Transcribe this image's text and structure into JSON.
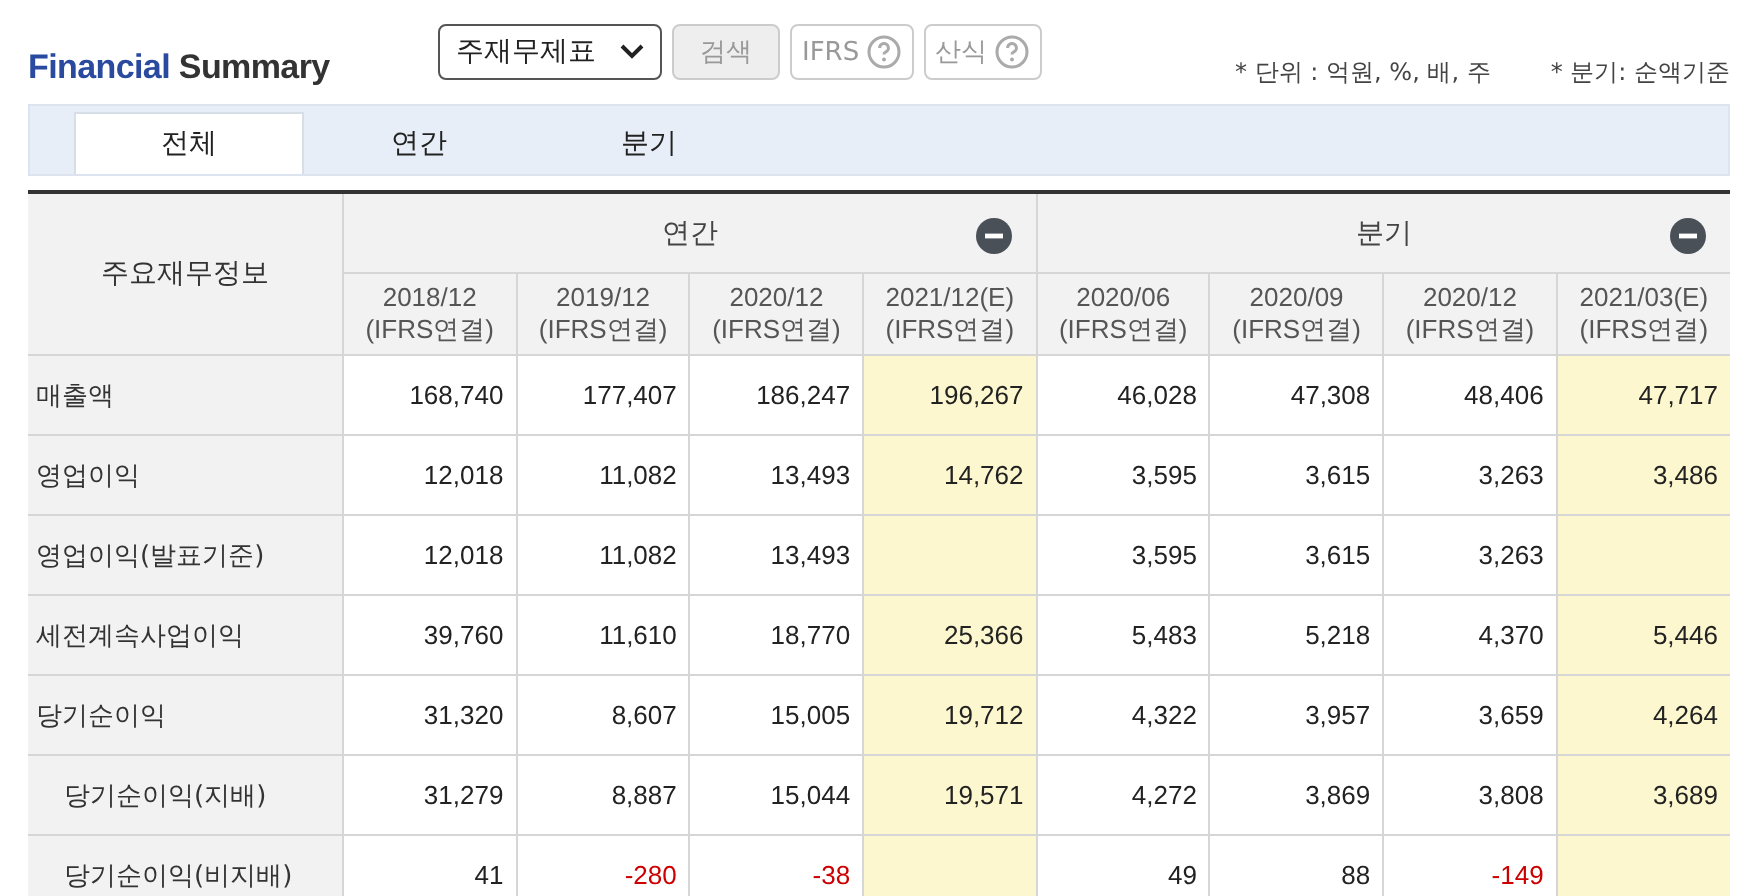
{
  "title": {
    "part_1": "Financial",
    "part_2": "Summary"
  },
  "controls": {
    "select_value": "주재무제표",
    "search_button": "검색",
    "ifrs_button": "IFRS",
    "formula_button": "산식"
  },
  "notes": [
    "* 단위 : 억원, %, 배, 주",
    "* 분기: 순액기준"
  ],
  "tabs": [
    {
      "label": "전체",
      "selected": true
    },
    {
      "label": "연간",
      "selected": false
    },
    {
      "label": "분기",
      "selected": false
    }
  ],
  "table": {
    "row_header": "주요재무정보",
    "groups": [
      {
        "label": "연간",
        "expanded": true,
        "columns": [
          {
            "period": "2018/12",
            "basis": "(IFRS연결)",
            "estimate": false
          },
          {
            "period": "2019/12",
            "basis": "(IFRS연결)",
            "estimate": false
          },
          {
            "period": "2020/12",
            "basis": "(IFRS연결)",
            "estimate": false
          },
          {
            "period": "2021/12(E)",
            "basis": "(IFRS연결)",
            "estimate": true
          }
        ]
      },
      {
        "label": "분기",
        "expanded": true,
        "columns": [
          {
            "period": "2020/06",
            "basis": "(IFRS연결)",
            "estimate": false
          },
          {
            "period": "2020/09",
            "basis": "(IFRS연결)",
            "estimate": false
          },
          {
            "period": "2020/12",
            "basis": "(IFRS연결)",
            "estimate": false
          },
          {
            "period": "2021/03(E)",
            "basis": "(IFRS연결)",
            "estimate": true
          }
        ]
      }
    ],
    "rows": [
      {
        "label": "매출액",
        "values": [
          [
            "168,740",
            "177,407",
            "186,247",
            "196,267"
          ],
          [
            "46,028",
            "47,308",
            "48,406",
            "47,717"
          ]
        ]
      },
      {
        "label": "영업이익",
        "values": [
          [
            "12,018",
            "11,082",
            "13,493",
            "14,762"
          ],
          [
            "3,595",
            "3,615",
            "3,263",
            "3,486"
          ]
        ]
      },
      {
        "label": "영업이익(발표기준)",
        "values": [
          [
            "12,018",
            "11,082",
            "13,493"
          ],
          [
            "3,595",
            "3,615",
            "3,263"
          ]
        ]
      },
      {
        "label": "세전계속사업이익",
        "values": [
          [
            "39,760",
            "11,610",
            "18,770",
            "25,366"
          ],
          [
            "5,483",
            "5,218",
            "4,370",
            "5,446"
          ]
        ]
      },
      {
        "label": "당기순이익",
        "values": [
          [
            "31,320",
            "8,607",
            "15,005",
            "19,712"
          ],
          [
            "4,322",
            "3,957",
            "3,659",
            "4,264"
          ]
        ],
        "children": [
          {
            "label": "당기순이익(지배)",
            "values": [
              [
                "31,279",
                "8,887",
                "15,044",
                "19,571"
              ],
              [
                "4,272",
                "3,869",
                "3,808",
                "3,689"
              ]
            ]
          },
          {
            "label": "당기순이익(비지배)",
            "values": [
              [
                "41",
                "-280",
                "-38"
              ],
              [
                "49",
                "88",
                "-149"
              ]
            ]
          }
        ]
      }
    ]
  }
}
